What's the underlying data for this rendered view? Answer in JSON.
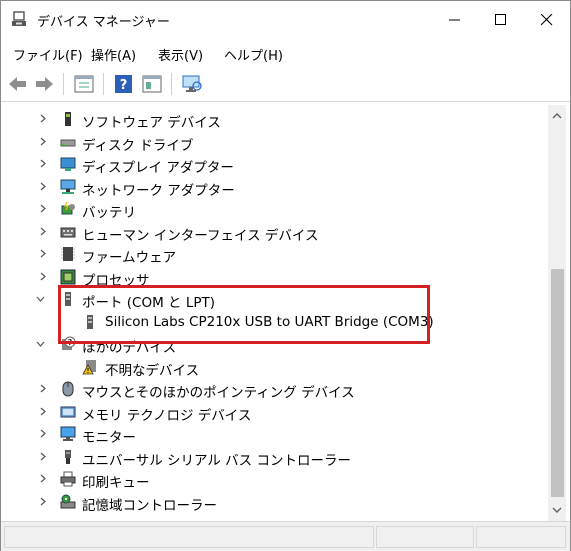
{
  "window": {
    "title": "デバイス マネージャー"
  },
  "menu": [
    {
      "label": "ファイル(F)"
    },
    {
      "label": "操作(A)"
    },
    {
      "label": "表示(V)"
    },
    {
      "label": "ヘルプ(H)"
    }
  ],
  "tree": [
    {
      "label": "ソフトウェア デバイス",
      "icon": "software-device-icon",
      "state": "collapsed"
    },
    {
      "label": "ディスク ドライブ",
      "icon": "disk-drive-icon",
      "state": "collapsed"
    },
    {
      "label": "ディスプレイ アダプター",
      "icon": "display-adapter-icon",
      "state": "collapsed"
    },
    {
      "label": "ネットワーク アダプター",
      "icon": "network-adapter-icon",
      "state": "collapsed"
    },
    {
      "label": "バッテリ",
      "icon": "battery-icon",
      "state": "collapsed"
    },
    {
      "label": "ヒューマン インターフェイス デバイス",
      "icon": "hid-icon",
      "state": "collapsed"
    },
    {
      "label": "ファームウェア",
      "icon": "firmware-icon",
      "state": "collapsed"
    },
    {
      "label": "プロセッサ",
      "icon": "processor-icon",
      "state": "collapsed"
    },
    {
      "label": "ポート (COM と LPT)",
      "icon": "port-icon",
      "state": "expanded"
    },
    {
      "label": "Silicon Labs CP210x USB to UART Bridge (COM3)",
      "icon": "port-icon",
      "state": "child"
    },
    {
      "label": "ほかのデバイス",
      "icon": "other-device-icon",
      "state": "expanded"
    },
    {
      "label": "不明なデバイス",
      "icon": "unknown-device-warning-icon",
      "state": "child"
    },
    {
      "label": "マウスとそのほかのポインティング デバイス",
      "icon": "mouse-icon",
      "state": "collapsed"
    },
    {
      "label": "メモリ テクノロジ デバイス",
      "icon": "memory-icon",
      "state": "collapsed"
    },
    {
      "label": "モニター",
      "icon": "monitor-icon",
      "state": "collapsed"
    },
    {
      "label": "ユニバーサル シリアル バス コントローラー",
      "icon": "usb-icon",
      "state": "collapsed"
    },
    {
      "label": "印刷キュー",
      "icon": "printer-icon",
      "state": "collapsed"
    },
    {
      "label": "記憶域コントローラー",
      "icon": "storage-controller-icon",
      "state": "collapsed"
    }
  ],
  "colors": {
    "highlight": "#d42020",
    "accent": "#2b6fc9"
  }
}
